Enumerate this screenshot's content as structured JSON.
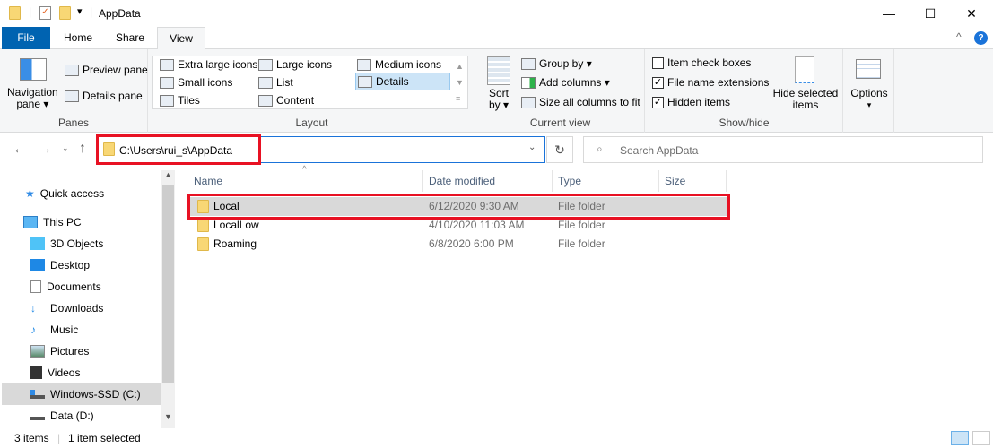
{
  "window": {
    "title": "AppData",
    "minimize": "—",
    "maximize": "☐",
    "close": "✕"
  },
  "tabs": [
    {
      "label": "File"
    },
    {
      "label": "Home"
    },
    {
      "label": "Share"
    },
    {
      "label": "View"
    }
  ],
  "ribbon": {
    "panes": {
      "label": "Panes",
      "navigation_pane": "Navigation",
      "navigation_pane2": "pane ▾",
      "preview_pane": "Preview pane",
      "details_pane": "Details pane"
    },
    "layout": {
      "label": "Layout",
      "items": [
        "Extra large icons",
        "Large icons",
        "Medium icons",
        "Small icons",
        "List",
        "Details",
        "Tiles",
        "Content"
      ],
      "selected": "Details"
    },
    "current_view": {
      "label": "Current view",
      "sort_by": "Sort",
      "sort_by2": "by ▾",
      "group_by": "Group by ▾",
      "add_columns": "Add columns ▾",
      "size_all": "Size all columns to fit"
    },
    "show_hide": {
      "label": "Show/hide",
      "item_check_boxes": {
        "label": "Item check boxes",
        "checked": false
      },
      "file_name_extensions": {
        "label": "File name extensions",
        "checked": true
      },
      "hidden_items": {
        "label": "Hidden items",
        "checked": true
      },
      "hide_selected": "Hide selected",
      "hide_selected2": "items"
    },
    "options": {
      "label": "Options",
      "arrow": "▾"
    }
  },
  "address": {
    "path": "C:\\Users\\rui_s\\AppData",
    "search_placeholder": "Search AppData"
  },
  "nav": [
    {
      "label": "Quick access",
      "icon": "star-icon"
    },
    {
      "label": "This PC",
      "icon": "computer-icon"
    },
    {
      "label": "3D Objects",
      "icon": "cube-icon"
    },
    {
      "label": "Desktop",
      "icon": "desktop-icon"
    },
    {
      "label": "Documents",
      "icon": "document-icon"
    },
    {
      "label": "Downloads",
      "icon": "download-icon"
    },
    {
      "label": "Music",
      "icon": "music-icon"
    },
    {
      "label": "Pictures",
      "icon": "picture-icon"
    },
    {
      "label": "Videos",
      "icon": "video-icon"
    },
    {
      "label": "Windows-SSD (C:)",
      "icon": "drive-icon",
      "selected": true
    },
    {
      "label": "Data (D:)",
      "icon": "drive-icon"
    }
  ],
  "columns": [
    "Name",
    "Date modified",
    "Type",
    "Size"
  ],
  "files": [
    {
      "name": "Local",
      "date": "6/12/2020 9:30 AM",
      "type": "File folder",
      "selected": true
    },
    {
      "name": "LocalLow",
      "date": "4/10/2020 11:03 AM",
      "type": "File folder"
    },
    {
      "name": "Roaming",
      "date": "6/8/2020 6:00 PM",
      "type": "File folder"
    }
  ],
  "status": {
    "count": "3 items",
    "selected": "1 item selected"
  },
  "colors": {
    "accent": "#0063b1",
    "highlight": "#e81123",
    "selection": "#d9d9d9",
    "folder": "#f8d775"
  }
}
